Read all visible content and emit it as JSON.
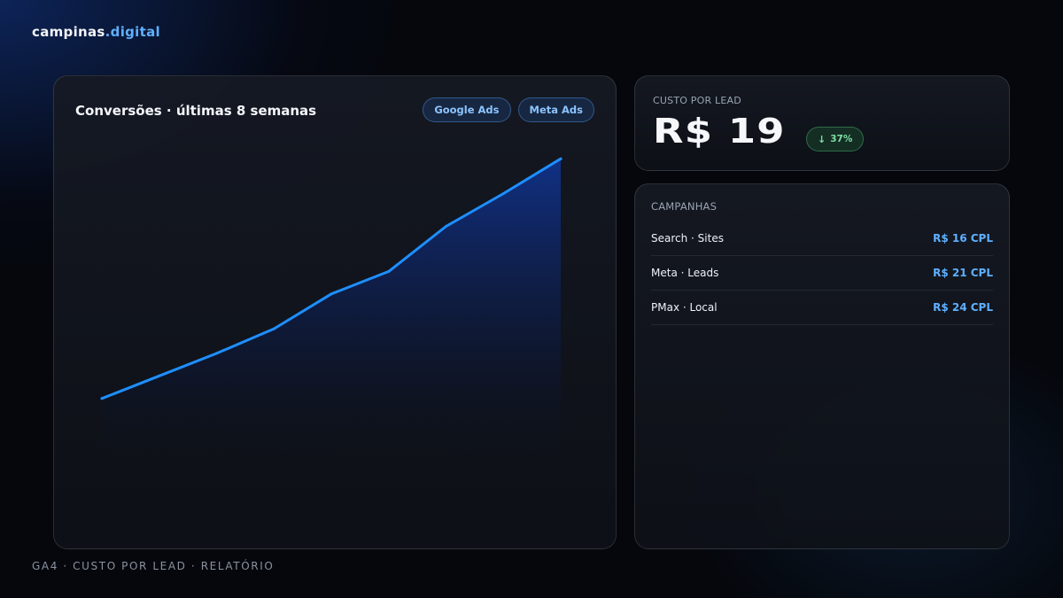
{
  "brand": {
    "name": "campinas",
    "suffix": ".digital"
  },
  "chart_card": {
    "title": "Conversões · últimas 8 semanas",
    "legend": [
      "Google Ads",
      "Meta Ads"
    ]
  },
  "chart_data": {
    "type": "area",
    "title": "Conversões · últimas 8 semanas",
    "x": [
      1,
      2,
      3,
      4,
      5,
      6,
      7,
      8,
      9
    ],
    "series": [
      {
        "values": [
          20,
          31,
          42,
          54,
          71,
          82,
          104,
          120,
          137
        ]
      }
    ],
    "ylim": [
      0,
      160
    ],
    "grid": false,
    "colors": {
      "line": "#1e8fff",
      "fill_top": "#0f3aa8"
    }
  },
  "cpl": {
    "label": "CUSTO POR LEAD",
    "value": "R$ 19",
    "change": "37%",
    "change_icon": "arrow-down-icon"
  },
  "campaigns": {
    "title": "CAMPANHAS",
    "items": [
      {
        "name": "Search · Sites",
        "cpl": "R$ 16 CPL"
      },
      {
        "name": "Meta · Leads",
        "cpl": "R$ 21 CPL"
      },
      {
        "name": "PMax · Local",
        "cpl": "R$ 24 CPL"
      }
    ]
  },
  "footer": "GA4 · CUSTO POR LEAD · RELATÓRIO"
}
